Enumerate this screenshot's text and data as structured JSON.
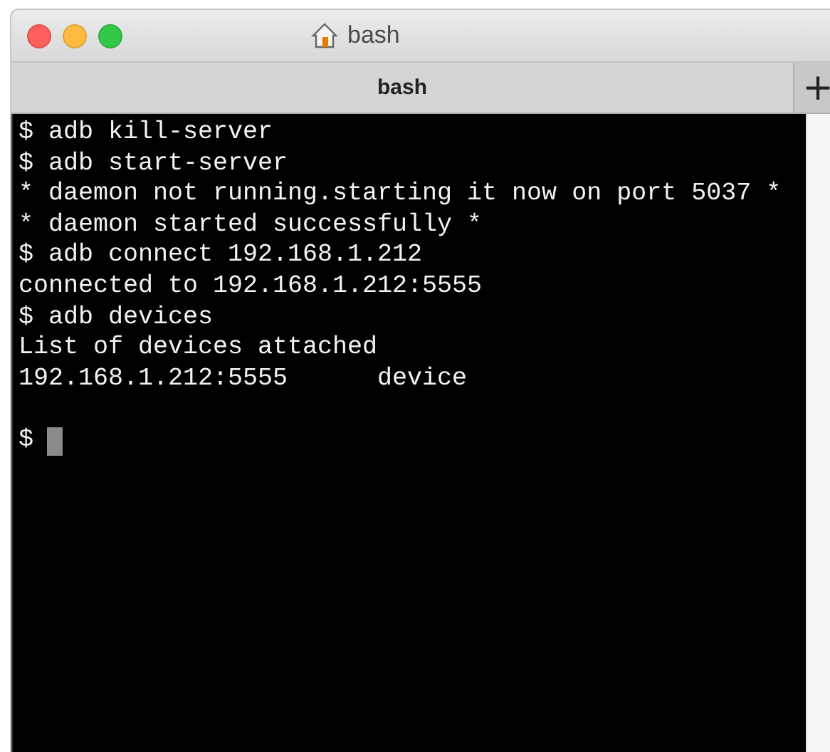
{
  "window": {
    "title": "bash"
  },
  "tabs": [
    {
      "label": "bash",
      "selected": true
    }
  ],
  "new_tab_button": "+",
  "terminal": {
    "lines": [
      "$ adb kill-server",
      "$ adb start-server",
      "* daemon not running.starting it now on port 5037 *",
      "* daemon started successfully *",
      "$ adb connect 192.168.1.212",
      "connected to 192.168.1.212:5555",
      "$ adb devices",
      "List of devices attached",
      "192.168.1.212:5555      device"
    ],
    "prompt": "$"
  }
}
